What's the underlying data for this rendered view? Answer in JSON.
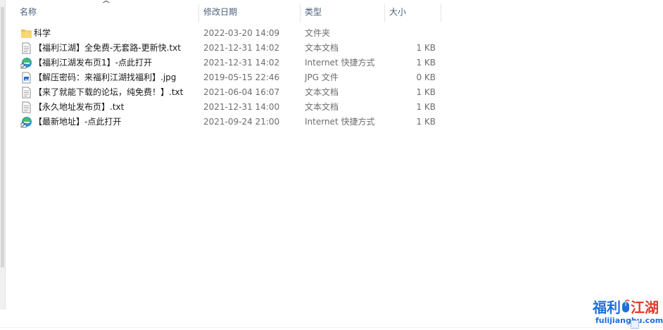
{
  "columns": {
    "name": "名称",
    "date": "修改日期",
    "type": "类型",
    "size": "大小"
  },
  "files": [
    {
      "name": "科学",
      "date": "2022-03-20 14:09",
      "type": "文件夹",
      "size": "",
      "icon": "folder-icon"
    },
    {
      "name": "【福利江湖】全免费-无套路-更新快.txt",
      "date": "2021-12-31 14:02",
      "type": "文本文档",
      "size": "1 KB",
      "icon": "text-file-icon"
    },
    {
      "name": "【福利江湖发布页1】-点此打开",
      "date": "2021-12-31 14:02",
      "type": "Internet 快捷方式",
      "size": "1 KB",
      "icon": "internet-shortcut-icon"
    },
    {
      "name": "【解压密码：来福利江湖找福利】.jpg",
      "date": "2019-05-15 22:46",
      "type": "JPG 文件",
      "size": "0 KB",
      "icon": "image-file-icon"
    },
    {
      "name": "【来了就能下载的论坛，纯免费！】.txt",
      "date": "2021-06-04 16:07",
      "type": "文本文档",
      "size": "1 KB",
      "icon": "text-file-icon"
    },
    {
      "name": "【永久地址发布页】.txt",
      "date": "2021-12-31 14:00",
      "type": "文本文档",
      "size": "1 KB",
      "icon": "text-file-icon"
    },
    {
      "name": "【最新地址】-点此打开",
      "date": "2021-09-24 21:00",
      "type": "Internet 快捷方式",
      "size": "1 KB",
      "icon": "internet-shortcut-icon"
    }
  ],
  "watermark": {
    "title_blue1": "福利",
    "title_blue2": "江湖",
    "domain": "fulijianghu.com"
  },
  "colors": {
    "header_text": "#4c607a",
    "folder": "#f8d775",
    "logo_blue": "#1f6fd6",
    "logo_red": "#e23a2e"
  }
}
